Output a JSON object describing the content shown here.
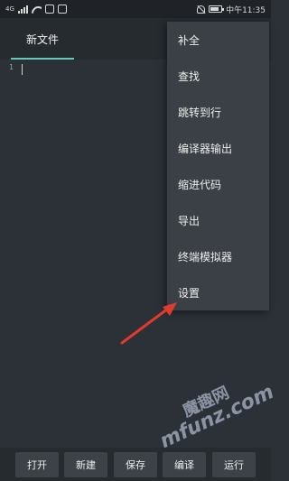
{
  "status_bar": {
    "signal_text": "4G",
    "time": "中午11:35"
  },
  "tab": {
    "label": "新文件"
  },
  "editor": {
    "line_number": "1"
  },
  "menu": {
    "items": [
      "补全",
      "查找",
      "跳转到行",
      "编译器输出",
      "缩进代码",
      "导出",
      "终端模拟器",
      "设置"
    ]
  },
  "bottom_buttons": [
    "打开",
    "新建",
    "保存",
    "编译",
    "运行"
  ],
  "watermark": {
    "top": "魔趣网",
    "bottom": "mfunz.com"
  },
  "colors": {
    "accent": "#66c8b8",
    "arrow": "#e03a2e"
  }
}
